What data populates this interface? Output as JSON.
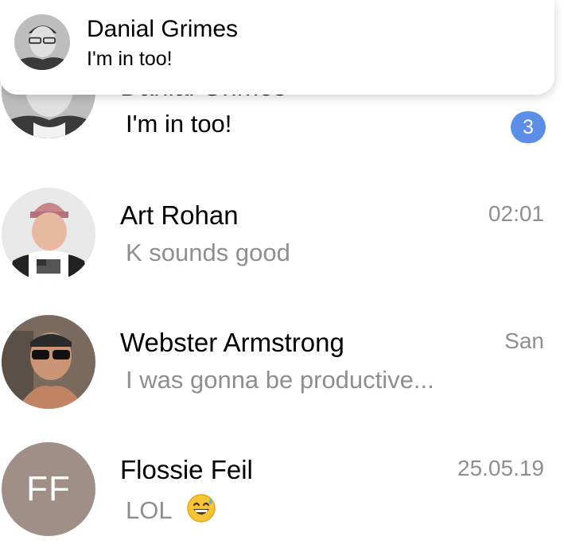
{
  "notification": {
    "sender": "Danial Grimes",
    "message": "I'm in too!"
  },
  "chats": [
    {
      "name": "Danial Grimes",
      "preview": "I'm in too!",
      "time": "",
      "unread_count": "3",
      "avatar_icon": "person-photo-glasses-avatar"
    },
    {
      "name": "Art Rohan",
      "preview": "K sounds good",
      "time": "02:01",
      "avatar_icon": "person-photo-beanie-avatar"
    },
    {
      "name": "Webster Armstrong",
      "preview": "I was gonna be productive...",
      "time": "San",
      "avatar_icon": "person-photo-sunglasses-avatar"
    },
    {
      "name": "Flossie Feil",
      "preview": "LOL",
      "time": "25.05.19",
      "avatar_initials": "FF",
      "preview_emoji": "grinning-sweat-emoji"
    }
  ],
  "colors": {
    "badge": "#5b8ee6",
    "secondary_text": "#8e8e93",
    "initials_avatar": "#a08f86"
  }
}
